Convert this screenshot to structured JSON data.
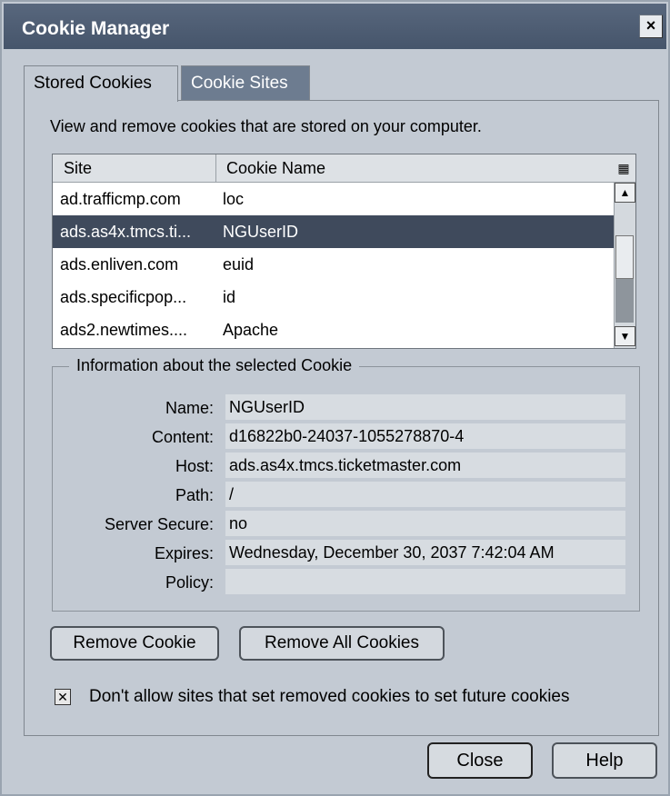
{
  "window": {
    "title": "Cookie Manager",
    "close_glyph": "×"
  },
  "tabs": [
    {
      "label": "Stored Cookies",
      "active": true
    },
    {
      "label": "Cookie Sites",
      "active": false
    }
  ],
  "description": "View and remove cookies that are stored on your computer.",
  "cookie_list": {
    "columns": [
      "Site",
      "Cookie Name"
    ],
    "rows": [
      {
        "site": "ad.trafficmp.com",
        "cookie": "loc"
      },
      {
        "site": "ads.as4x.tmcs.ti...",
        "cookie": "NGUserID",
        "selected": true
      },
      {
        "site": "ads.enliven.com",
        "cookie": "euid"
      },
      {
        "site": "ads.specificpop...",
        "cookie": "id"
      },
      {
        "site": "ads2.newtimes....",
        "cookie": "Apache"
      }
    ]
  },
  "info": {
    "legend": "Information about the selected Cookie",
    "fields": [
      {
        "label": "Name:",
        "value": "NGUserID"
      },
      {
        "label": "Content:",
        "value": "d16822b0-24037-1055278870-4"
      },
      {
        "label": "Host:",
        "value": "ads.as4x.tmcs.ticketmaster.com"
      },
      {
        "label": "Path:",
        "value": "/"
      },
      {
        "label": "Server Secure:",
        "value": "no"
      },
      {
        "label": "Expires:",
        "value": "Wednesday, December 30, 2037 7:42:04 AM"
      },
      {
        "label": "Policy:",
        "value": ""
      }
    ]
  },
  "buttons": {
    "remove_cookie": "Remove Cookie",
    "remove_all": "Remove All Cookies",
    "close": "Close",
    "help": "Help"
  },
  "checkbox": {
    "label": "Don't allow sites that set removed cookies to set future cookies",
    "checked": true
  }
}
